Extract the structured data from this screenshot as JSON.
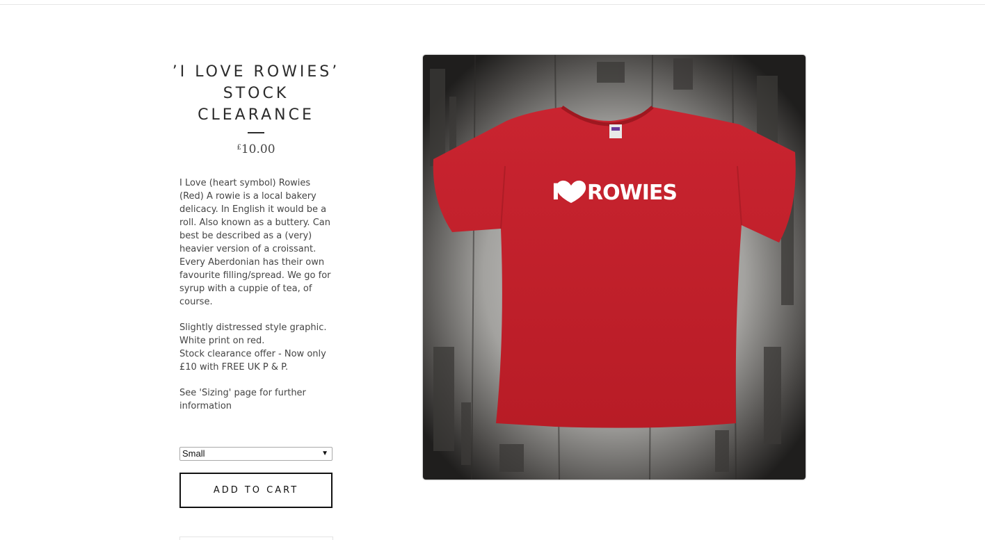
{
  "product": {
    "title": "’I LOVE ROWIES’ STOCK CLEARANCE",
    "price_currency": "£",
    "price_amount": "10.00",
    "description": {
      "para1": "I Love (heart symbol) Rowies (Red) A rowie is a local bakery delicacy. In English it would be a roll. Also known as a buttery. Can best be described as a (very) heavier version of a croissant. Every Aberdonian has their own favourite filling/spread. We go for syrup with a cuppie of tea, of course.",
      "line1": "Slightly distressed style graphic.",
      "line2": "White print on red.",
      "line3": "Stock clearance offer - Now only £10 with FREE UK P & P.",
      "para3": "See 'Sizing' page for further information"
    },
    "size_select": {
      "selected": "Small",
      "arrow_icon": "dropdown-arrow-icon"
    },
    "add_to_cart_label": "ADD TO CART",
    "image": {
      "shirt_print": "I ❤ ROWIES",
      "colors": {
        "shirt": "#c3212b",
        "wood": "#3a3836",
        "print": "#ffffff"
      }
    }
  }
}
